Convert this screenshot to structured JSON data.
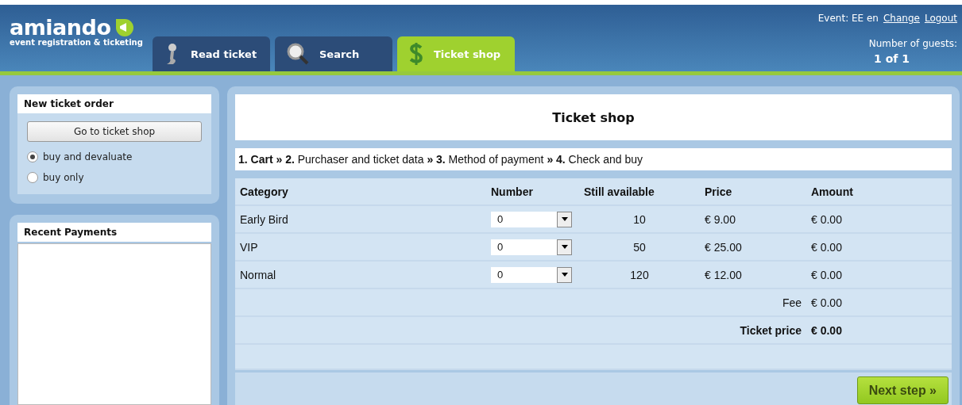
{
  "logo": {
    "name": "amiando",
    "tagline": "event registration & ticketing"
  },
  "tabs": [
    {
      "label": "Read ticket",
      "selected": false
    },
    {
      "label": "Search",
      "selected": false
    },
    {
      "label": "Ticket shop",
      "selected": true
    }
  ],
  "account": {
    "event": "Event: EE en",
    "links": [
      "Change",
      "Logout"
    ],
    "guests_label": "Number of guests:",
    "guests_value": "1 of 1"
  },
  "new_order": {
    "title": "New ticket order",
    "button": "Go to ticket shop",
    "options": [
      {
        "label": "buy and devaluate",
        "selected": true
      },
      {
        "label": "buy only",
        "selected": false
      }
    ]
  },
  "recent_payments": {
    "title": "Recent Payments"
  },
  "shop": {
    "title": "Ticket shop",
    "steps": "**1. Cart » 2.** Purchaser and ticket data **» 3.** Method of payment **» 4.** Check and buy",
    "columns": [
      "Category",
      "Number",
      "Still available",
      "Price",
      "Amount"
    ],
    "rows": [
      {
        "category": "Early Bird",
        "number": "0",
        "available": "10",
        "price": "€ 9.00",
        "amount": "€ 0.00"
      },
      {
        "category": "VIP",
        "number": "0",
        "available": "50",
        "price": "€ 25.00",
        "amount": "€ 0.00"
      },
      {
        "category": "Normal",
        "number": "0",
        "available": "120",
        "price": "€ 12.00",
        "amount": "€ 0.00"
      }
    ],
    "totals": [
      {
        "label": "Fee",
        "value": "€ 0.00"
      },
      {
        "label": "Ticket price",
        "value": "€ 0.00"
      }
    ],
    "next_button": "Next step »"
  }
}
